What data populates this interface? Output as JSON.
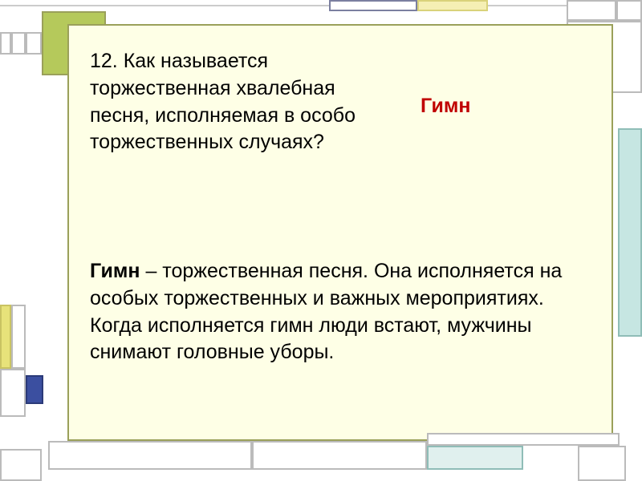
{
  "question": "12. Как называется торжественная хвалебная песня, исполняемая в особо торжественных случаях?",
  "answer": "Гимн",
  "definition_term": "Гимн",
  "definition_body": " – торжественная песня. Она исполняется на особых торжественных  и важных мероприятиях. Когда исполняется гимн люди встают, мужчины снимают головные уборы."
}
